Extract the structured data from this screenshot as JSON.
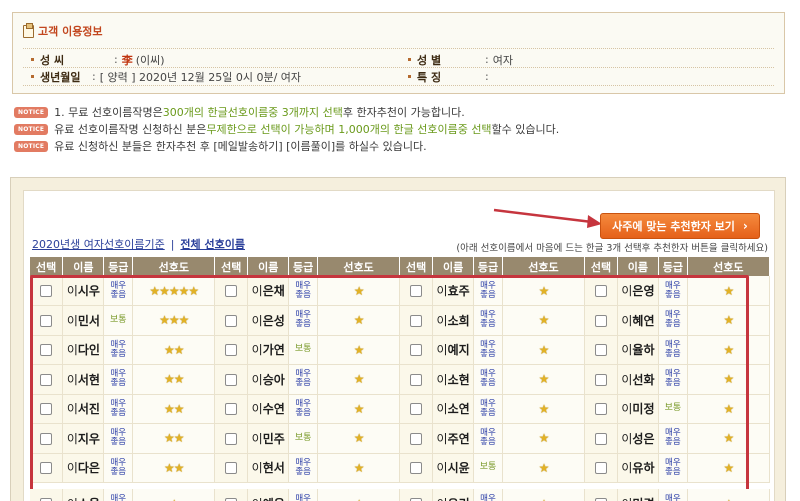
{
  "info": {
    "title": "고객 이용정보",
    "surname_label": "성 씨",
    "surname_hanja": "李",
    "surname_rest": "(이씨)",
    "gender_label": "성 별",
    "gender_value": "여자",
    "birth_label": "생년월일",
    "birth_value": "[ 양력 ] 2020년 12월 25일 0시 0분/ 여자",
    "trait_label": "특 징",
    "trait_value": ""
  },
  "notices": {
    "badge": "NOTICE",
    "n1_a": "1. 무료 선호이름작명은 ",
    "n1_hl": "300개의 한글선호이름중 3개까지 선택",
    "n1_b": "후 한자추천이 가능합니다.",
    "n2_a": "유료 선호이름작명 신청하신 분은",
    "n2_hl1": "무제한으로 선택이 가능하며 1,000개의 한글 선호이름중 선택",
    "n2_b": "할수 있습니다.",
    "n3": "유료 신청하신 분들은 한자추천 후 [메일발송하기] [이름풀이]를 하실수 있습니다."
  },
  "recommend_button": "사주에 맞는 추천한자 보기",
  "tabs": {
    "tab1": "2020년생 여자선호이름기준",
    "separator": "|",
    "tab2": "전체 선호이름"
  },
  "helper": "(아래 선호이름에서 마음에 드는 한글 3개 선택후 추천한자 버튼을 클릭하세요)",
  "headers": {
    "select": "선택",
    "name": "이름",
    "grade": "등급",
    "pref": "선호도"
  },
  "surname": "이",
  "grade_labels": {
    "top": "매우좋음",
    "normal": "보통"
  },
  "rows": [
    [
      {
        "name": "시우",
        "grade": "top",
        "stars": 5
      },
      {
        "name": "은채",
        "grade": "top",
        "stars": 1
      },
      {
        "name": "효주",
        "grade": "top",
        "stars": 1
      },
      {
        "name": "은영",
        "grade": "top",
        "stars": 1
      }
    ],
    [
      {
        "name": "민서",
        "grade": "normal",
        "stars": 3
      },
      {
        "name": "은성",
        "grade": "top",
        "stars": 1
      },
      {
        "name": "소희",
        "grade": "top",
        "stars": 1
      },
      {
        "name": "혜연",
        "grade": "top",
        "stars": 1
      }
    ],
    [
      {
        "name": "다인",
        "grade": "top",
        "stars": 2
      },
      {
        "name": "가연",
        "grade": "normal",
        "stars": 1
      },
      {
        "name": "예지",
        "grade": "top",
        "stars": 1
      },
      {
        "name": "율하",
        "grade": "top",
        "stars": 1
      }
    ],
    [
      {
        "name": "서현",
        "grade": "top",
        "stars": 2
      },
      {
        "name": "승아",
        "grade": "top",
        "stars": 1
      },
      {
        "name": "소현",
        "grade": "top",
        "stars": 1
      },
      {
        "name": "선화",
        "grade": "top",
        "stars": 1
      }
    ],
    [
      {
        "name": "서진",
        "grade": "top",
        "stars": 2
      },
      {
        "name": "수연",
        "grade": "top",
        "stars": 1
      },
      {
        "name": "소연",
        "grade": "top",
        "stars": 1
      },
      {
        "name": "미정",
        "grade": "normal",
        "stars": 1
      }
    ],
    [
      {
        "name": "지우",
        "grade": "top",
        "stars": 2
      },
      {
        "name": "민주",
        "grade": "normal",
        "stars": 1
      },
      {
        "name": "주연",
        "grade": "top",
        "stars": 1
      },
      {
        "name": "성은",
        "grade": "top",
        "stars": 1
      }
    ],
    [
      {
        "name": "다은",
        "grade": "top",
        "stars": 2
      },
      {
        "name": "현서",
        "grade": "top",
        "stars": 1
      },
      {
        "name": "시윤",
        "grade": "normal",
        "stars": 1
      },
      {
        "name": "유하",
        "grade": "top",
        "stars": 1
      }
    ]
  ],
  "partial_row": [
    "소율",
    "예은",
    "유리",
    "미경"
  ],
  "colors": {
    "header_bg": "#98896e",
    "button_orange": "#e5611a",
    "highlight_frame": "#c6353e",
    "grade_top": "#2d3fa8",
    "grade_normal": "#7a9a2b",
    "star": "#e2b226"
  }
}
